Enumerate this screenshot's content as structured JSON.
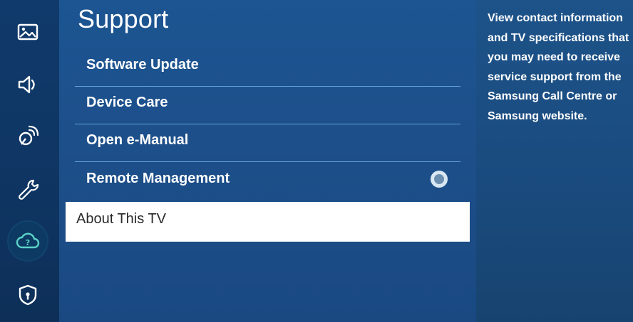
{
  "sidebar": {
    "icons": [
      {
        "name": "picture-icon"
      },
      {
        "name": "sound-icon"
      },
      {
        "name": "broadcasting-icon"
      },
      {
        "name": "general-icon"
      },
      {
        "name": "support-icon",
        "selected": true
      },
      {
        "name": "privacy-icon"
      }
    ]
  },
  "main": {
    "title": "Support",
    "items": [
      {
        "label": "Software Update"
      },
      {
        "label": "Device Care"
      },
      {
        "label": "Open e-Manual"
      },
      {
        "label": "Remote Management",
        "toggle": "off"
      },
      {
        "label": "About This TV",
        "focused": true
      }
    ]
  },
  "help": {
    "text": "View contact information and TV specifications that you may need to receive service support from the Samsung Call Centre or Samsung website."
  },
  "colors": {
    "background": "#1d4f8a",
    "rail": "#0f3664",
    "divider": "#78bef0",
    "focus": "#ffffff"
  }
}
